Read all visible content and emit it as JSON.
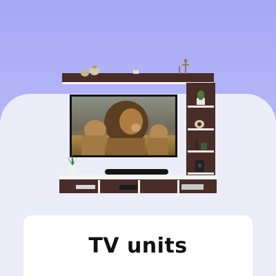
{
  "category_tile": {
    "label": "TV units",
    "image": {
      "subject": "tv-unit-with-lions-on-screen",
      "colors": {
        "background_top": "#a7a8f5",
        "panel": "#ececf8",
        "wood_dark": "#4a2c28",
        "shelf_white": "#f4f4f4"
      }
    }
  }
}
